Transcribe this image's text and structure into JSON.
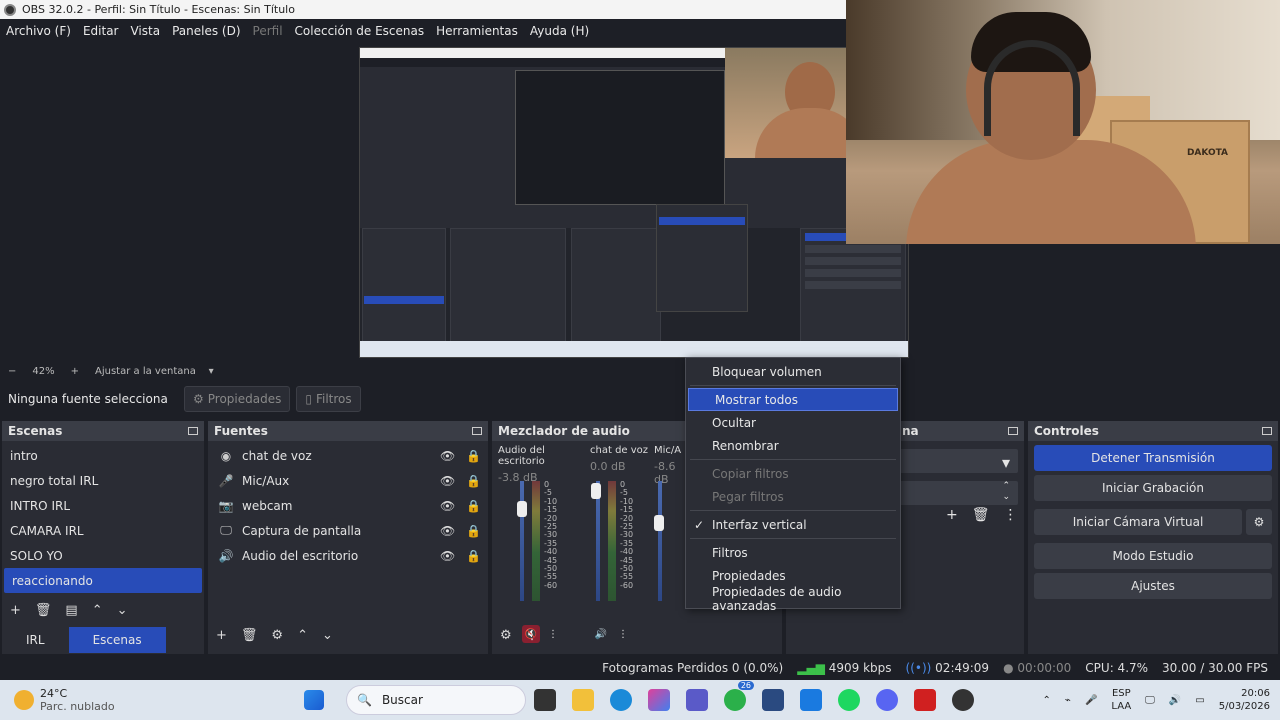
{
  "window": {
    "title": "OBS 32.0.2 - Perfil: Sin Título - Escenas: Sin Título"
  },
  "menu": [
    "Archivo (F)",
    "Editar",
    "Vista",
    "Paneles (D)",
    "Perfil",
    "Colección de Escenas",
    "Herramientas",
    "Ayuda (H)"
  ],
  "zoom": {
    "minus": "−",
    "level": "42%",
    "plus": "+",
    "fit_label": "Ajustar a la ventana"
  },
  "source_bar": {
    "no_selection": "Ninguna fuente selecciona",
    "properties": "Propiedades",
    "filters": "Filtros"
  },
  "scenes": {
    "title": "Escenas",
    "items": [
      "intro",
      "negro total IRL",
      "INTRO IRL",
      "CAMARA IRL",
      "SOLO YO",
      "reaccionando"
    ],
    "selected_index": 5,
    "tabs": [
      "IRL",
      "Escenas"
    ]
  },
  "sources": {
    "title": "Fuentes",
    "items": [
      {
        "icon": "sound-icon",
        "label": "chat de voz"
      },
      {
        "icon": "microphone-icon",
        "label": "Mic/Aux"
      },
      {
        "icon": "camera-icon",
        "label": "webcam"
      },
      {
        "icon": "monitor-icon",
        "label": "Captura de pantalla"
      },
      {
        "icon": "speaker-icon",
        "label": "Audio del escritorio"
      }
    ]
  },
  "mixer": {
    "title": "Mezclador de audio",
    "channels": [
      {
        "name": "Audio del escritorio",
        "db": "-3.8 dB"
      },
      {
        "name": "chat de voz",
        "db": "0.0 dB"
      },
      {
        "name": "Mic/A",
        "db": "-8.6 dB"
      }
    ],
    "scale": [
      "0",
      "-5",
      "-10",
      "-15",
      "-20",
      "-25",
      "-30",
      "-35",
      "-40",
      "-45",
      "-50",
      "-55",
      "-60"
    ]
  },
  "transitions": {
    "title_fragment": "na"
  },
  "controls": {
    "title": "Controles",
    "buttons": [
      "Detener Transmisión",
      "Iniciar Grabación",
      "Iniciar Cámara Virtual",
      "Modo Estudio",
      "Ajustes"
    ]
  },
  "context_menu": {
    "items": [
      {
        "label": "Bloquear volumen",
        "state": "normal"
      },
      {
        "label": "Mostrar todos",
        "state": "highlight"
      },
      {
        "label": "Ocultar",
        "state": "normal"
      },
      {
        "label": "Renombrar",
        "state": "normal"
      },
      {
        "label": "Copiar filtros",
        "state": "disabled"
      },
      {
        "label": "Pegar filtros",
        "state": "disabled"
      },
      {
        "label": "Interfaz vertical",
        "state": "checked"
      },
      {
        "label": "Filtros",
        "state": "normal"
      },
      {
        "label": "Propiedades",
        "state": "normal"
      },
      {
        "label": "Propiedades de audio avanzadas",
        "state": "normal"
      }
    ]
  },
  "status": {
    "dropped_frames": "Fotogramas Perdidos 0 (0.0%)",
    "bitrate": "4909 kbps",
    "stream_time": "02:49:09",
    "rec_time": "00:00:00",
    "cpu": "CPU: 4.7%",
    "fps": "30.00 / 30.00 FPS"
  },
  "webcam": {
    "box_label": "DAKOTA"
  },
  "taskbar": {
    "temperature": "24°C",
    "weather": "Parc. nublado",
    "search": "Buscar",
    "badge": "26",
    "language_top": "ESP",
    "language_bottom": "LAA",
    "time": "20:06",
    "date": "5/03/2026"
  },
  "colors": {
    "accent": "#284cb8",
    "panel": "#2a2c34",
    "background": "#1d1f26"
  }
}
